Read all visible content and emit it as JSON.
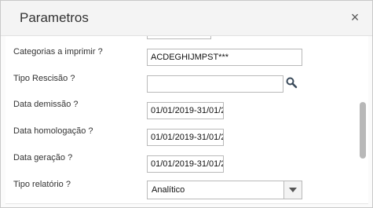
{
  "dialog": {
    "title": "Parametros",
    "close_glyph": "×"
  },
  "fields": {
    "categorias": {
      "label": "Categorias a imprimir ?",
      "value": "ACDEGHIJMPST***"
    },
    "tipo_rescisao": {
      "label": "Tipo Rescisão ?",
      "value": ""
    },
    "data_demissao": {
      "label": "Data demissão ?",
      "value": "01/01/2019-31/01/2"
    },
    "data_homologacao": {
      "label": "Data homologação ?",
      "value": "01/01/2019-31/01/2"
    },
    "data_geracao": {
      "label": "Data geração ?",
      "value": "01/01/2019-31/01/2"
    },
    "tipo_relatorio": {
      "label": "Tipo relatório ?",
      "value": "Analítico"
    }
  },
  "icons": {
    "search": "search-icon",
    "close": "close-icon",
    "dropdown": "chevron-down-icon"
  },
  "colors": {
    "titlebar_bg": "#f4f4f4",
    "border": "#b9b9b9",
    "scroll_thumb": "#b8b8b8"
  }
}
